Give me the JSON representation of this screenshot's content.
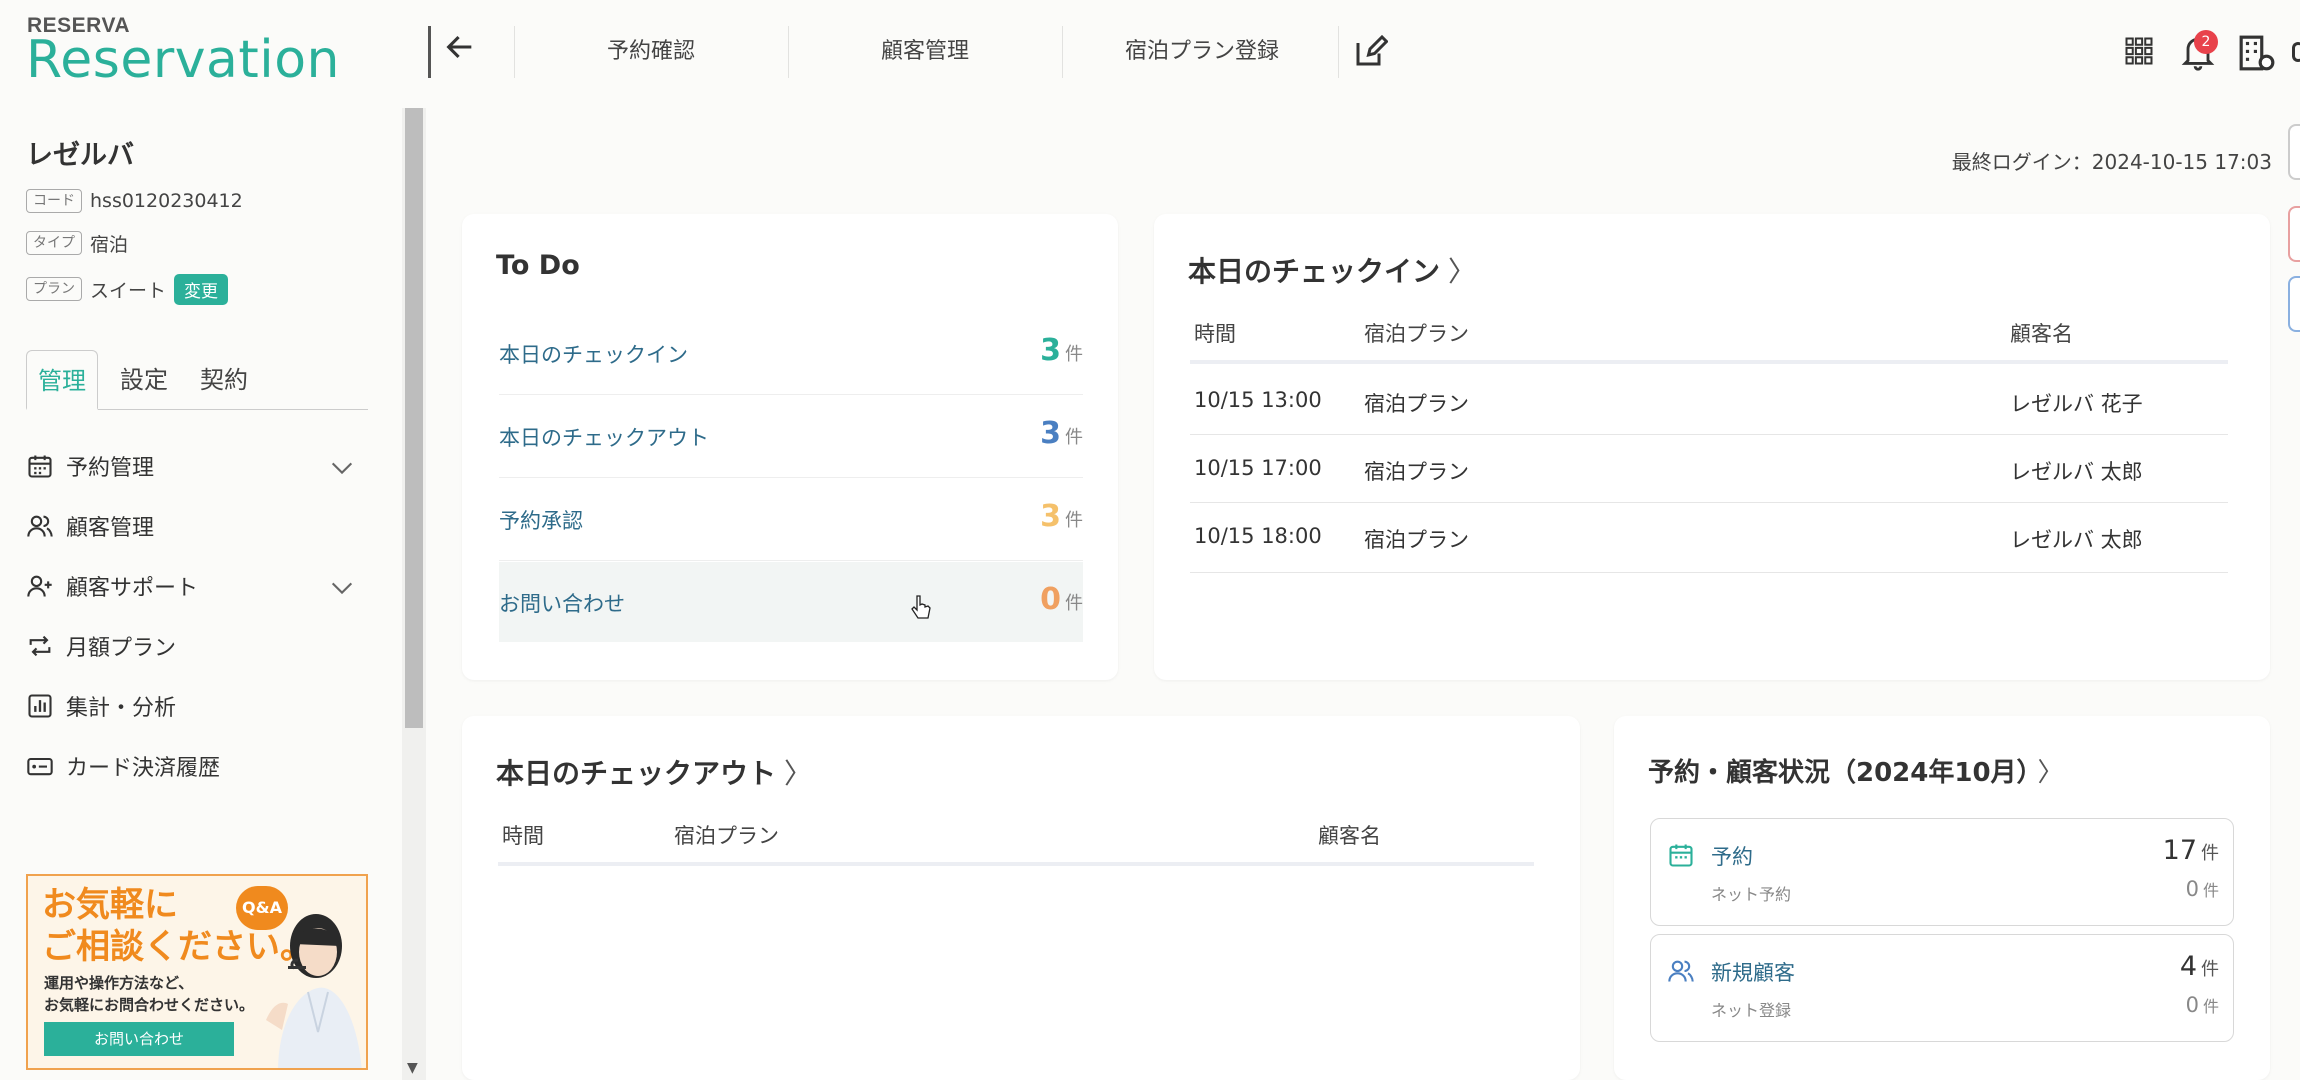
{
  "header": {
    "logo_small": "RESERVA",
    "logo_big": "Reservation",
    "nav": [
      "予約確認",
      "顧客管理",
      "宿泊プラン登録"
    ],
    "notification_count": "2"
  },
  "sidebar": {
    "shop_name": "レゼルバ",
    "code_tag": "コード",
    "code_value": "hss0120230412",
    "type_tag": "タイプ",
    "type_value": "宿泊",
    "plan_tag": "プラン",
    "plan_value": "スイート",
    "change_label": "変更",
    "tabs": [
      "管理",
      "設定",
      "契約"
    ],
    "menu": [
      {
        "label": "予約管理",
        "icon": "calendar-icon"
      },
      {
        "label": "顧客管理",
        "icon": "users-icon"
      },
      {
        "label": "顧客サポート",
        "icon": "user-plus-icon"
      },
      {
        "label": "月額プラン",
        "icon": "repeat-icon"
      },
      {
        "label": "集計・分析",
        "icon": "bar-chart-icon"
      },
      {
        "label": "カード決済履歴",
        "icon": "card-icon"
      }
    ],
    "banner": {
      "title_line1": "お気軽に",
      "title_line2": "ご相談ください。",
      "qa": "Q&A",
      "sub_line1": "運用や操作方法など、",
      "sub_line2": "お気軽にお問合わせください。",
      "button": "お問い合わせ"
    }
  },
  "main": {
    "last_login": "最終ログイン：2024-10-15 17:03",
    "todo": {
      "title": "To Do",
      "unit": "件",
      "items": [
        {
          "label": "本日のチェックイン",
          "count": "3",
          "color": "#2bb09a"
        },
        {
          "label": "本日のチェックアウト",
          "count": "3",
          "color": "#4a7fc1"
        },
        {
          "label": "予約承認",
          "count": "3",
          "color": "#f5c16b"
        },
        {
          "label": "お問い合わせ",
          "count": "0",
          "color": "#f0a060"
        }
      ]
    },
    "checkin": {
      "title": "本日のチェックイン",
      "arrow": "〉",
      "headers": [
        "時間",
        "宿泊プラン",
        "顧客名"
      ],
      "rows": [
        [
          "10/15 13:00",
          "宿泊プラン",
          "レゼルバ 花子"
        ],
        [
          "10/15 17:00",
          "宿泊プラン",
          "レゼルバ 太郎"
        ],
        [
          "10/15 18:00",
          "宿泊プラン",
          "レゼルバ 太郎"
        ]
      ]
    },
    "checkout": {
      "title": "本日のチェックアウト",
      "arrow": "〉",
      "headers": [
        "時間",
        "宿泊プラン",
        "顧客名"
      ]
    },
    "status": {
      "title": "予約・顧客状況（2024年10月）",
      "arrow": "〉",
      "unit": "件",
      "reservation_label": "予約",
      "reservation_count": "17",
      "reservation_sub": "ネット予約",
      "reservation_sub_count": "0",
      "customer_label": "新規顧客",
      "customer_count": "4",
      "customer_sub": "ネット登録",
      "customer_sub_count": "0"
    }
  }
}
